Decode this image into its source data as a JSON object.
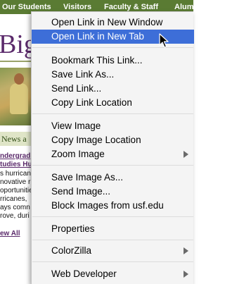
{
  "browser_page": {
    "nav": [
      "Our Students",
      "Visitors",
      "Faculty & Staff",
      "Alum"
    ],
    "title_fragment": "Big",
    "news_heading": "News a",
    "story_link": [
      "ndergrad",
      "tudies Hu"
    ],
    "story_text": [
      "s hurrican",
      "novative r",
      "oportunitie",
      "rricanes,",
      "ays comn",
      "rove, duri"
    ],
    "view_all": "ew All"
  },
  "context_menu": {
    "items": [
      {
        "label": "Open Link in New Window"
      },
      {
        "label": "Open Link in New Tab",
        "highlighted": true
      },
      {
        "label": "Bookmark This Link..."
      },
      {
        "label": "Save Link As..."
      },
      {
        "label": "Send Link..."
      },
      {
        "label": "Copy Link Location"
      },
      {
        "label": "View Image"
      },
      {
        "label": "Copy Image Location"
      },
      {
        "label": "Zoom Image",
        "submenu": true
      },
      {
        "label": "Save Image As..."
      },
      {
        "label": "Send Image..."
      },
      {
        "label": "Block Images from usf.edu"
      },
      {
        "label": "Properties"
      },
      {
        "label": "ColorZilla",
        "submenu": true
      },
      {
        "label": "Web Developer",
        "submenu": true
      }
    ]
  },
  "colors": {
    "nav_bar": "#5a7b33",
    "highlight": "#3d6ed8",
    "site_purple": "#5b2a6b"
  }
}
